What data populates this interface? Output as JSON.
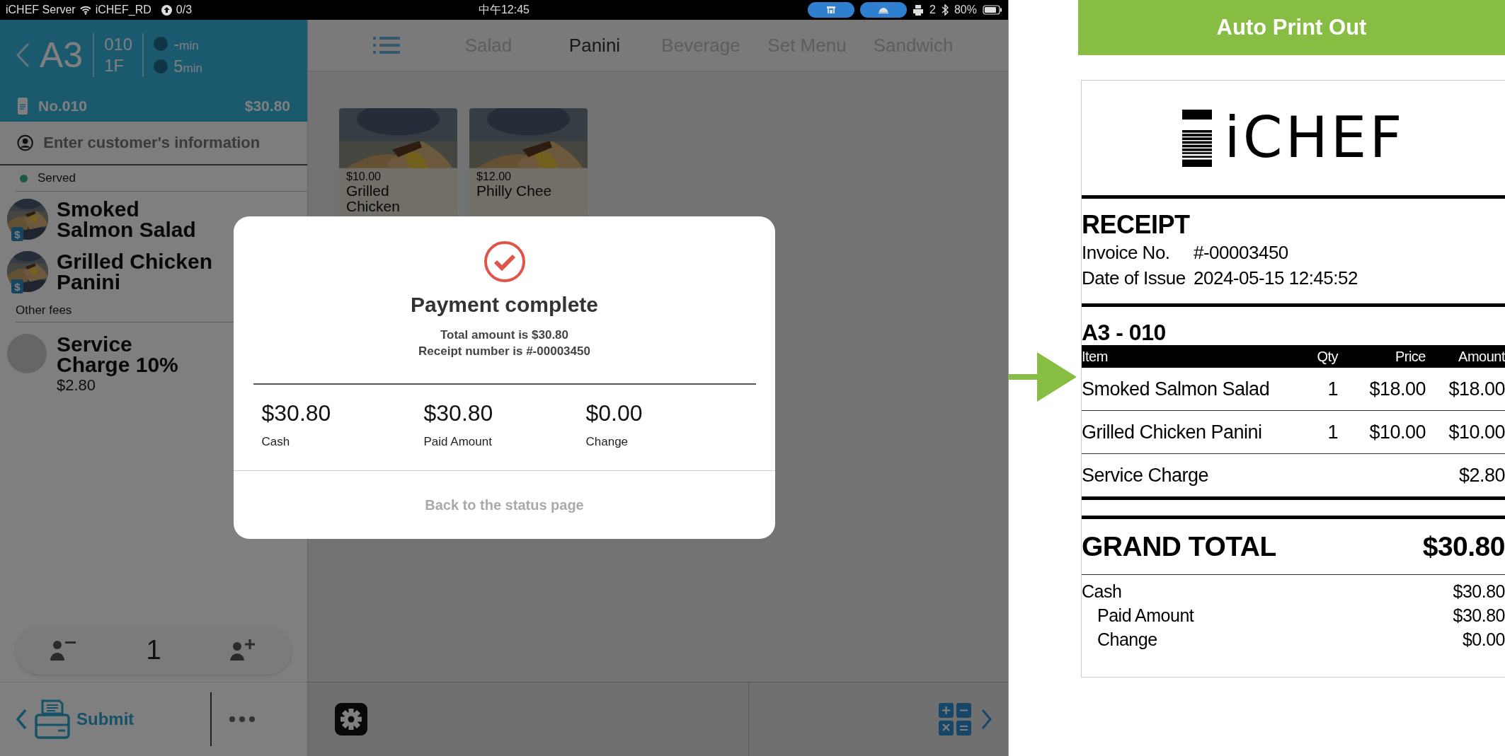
{
  "status_bar": {
    "device": "iCHEF Server",
    "network": "iCHEF_RD",
    "sync": "0/3",
    "time": "中午12:45",
    "printers": "2",
    "battery": "80%"
  },
  "order_panel": {
    "table": "A3",
    "number": "010",
    "floor": "1F",
    "timers": [
      {
        "value": "-",
        "unit": "min"
      },
      {
        "value": "5",
        "unit": "min"
      }
    ],
    "order_no": "No.010",
    "total": "$30.80",
    "customer_placeholder": "Enter customer's information",
    "status": "Served",
    "items": [
      {
        "name": "Smoked\nSalmon Salad",
        "badge": "$"
      },
      {
        "name": "Grilled Chicken\nPanini",
        "badge": "$"
      }
    ],
    "fees_header": "Other fees",
    "fees": [
      {
        "name": "Service\nCharge 10%",
        "price": "$2.80"
      }
    ],
    "guests": "1",
    "submit": "Submit"
  },
  "menu": {
    "tabs": [
      {
        "label": "Salad",
        "selected": false
      },
      {
        "label": "Panini",
        "selected": true
      },
      {
        "label": "Beverage",
        "selected": false
      },
      {
        "label": "Set Menu",
        "selected": false
      },
      {
        "label": "Sandwich",
        "selected": false
      }
    ],
    "cards": [
      {
        "price": "$10.00",
        "name": "Grilled\nChicken"
      },
      {
        "price": "$12.00",
        "name": "Philly Chee"
      }
    ]
  },
  "dialog": {
    "title": "Payment complete",
    "lines": [
      "Total amount is $30.80",
      "Receipt number is #-00003450"
    ],
    "amounts": [
      {
        "value": "$30.80",
        "label": "Cash"
      },
      {
        "value": "$30.80",
        "label": "Paid Amount"
      },
      {
        "value": "$0.00",
        "label": "Change"
      }
    ],
    "action": "Back to the status page"
  },
  "receipt": {
    "banner": "Auto Print Out",
    "logo": "iCHEF",
    "heading": "RECEIPT",
    "info": [
      {
        "label": "Invoice No.",
        "value": "#-00003450"
      },
      {
        "label": "Date of Issue",
        "value": "2024-05-15 12:45:52"
      }
    ],
    "table_name": "A3 - 010",
    "columns": [
      "Item",
      "Qty",
      "Price",
      "Amount"
    ],
    "rows": [
      {
        "item": "Smoked Salmon Salad",
        "qty": "1",
        "price": "$18.00",
        "amount": "$18.00"
      },
      {
        "item": "Grilled Chicken Panini",
        "qty": "1",
        "price": "$10.00",
        "amount": "$10.00"
      },
      {
        "item": "Service Charge",
        "amount": "$2.80"
      }
    ],
    "grand_total": {
      "label": "GRAND TOTAL",
      "value": "$30.80"
    },
    "payments": [
      {
        "label": "Cash",
        "value": "$30.80",
        "children": [
          {
            "label": "Paid Amount",
            "value": "$30.80"
          },
          {
            "label": "Change",
            "value": "$0.00"
          }
        ]
      }
    ]
  }
}
